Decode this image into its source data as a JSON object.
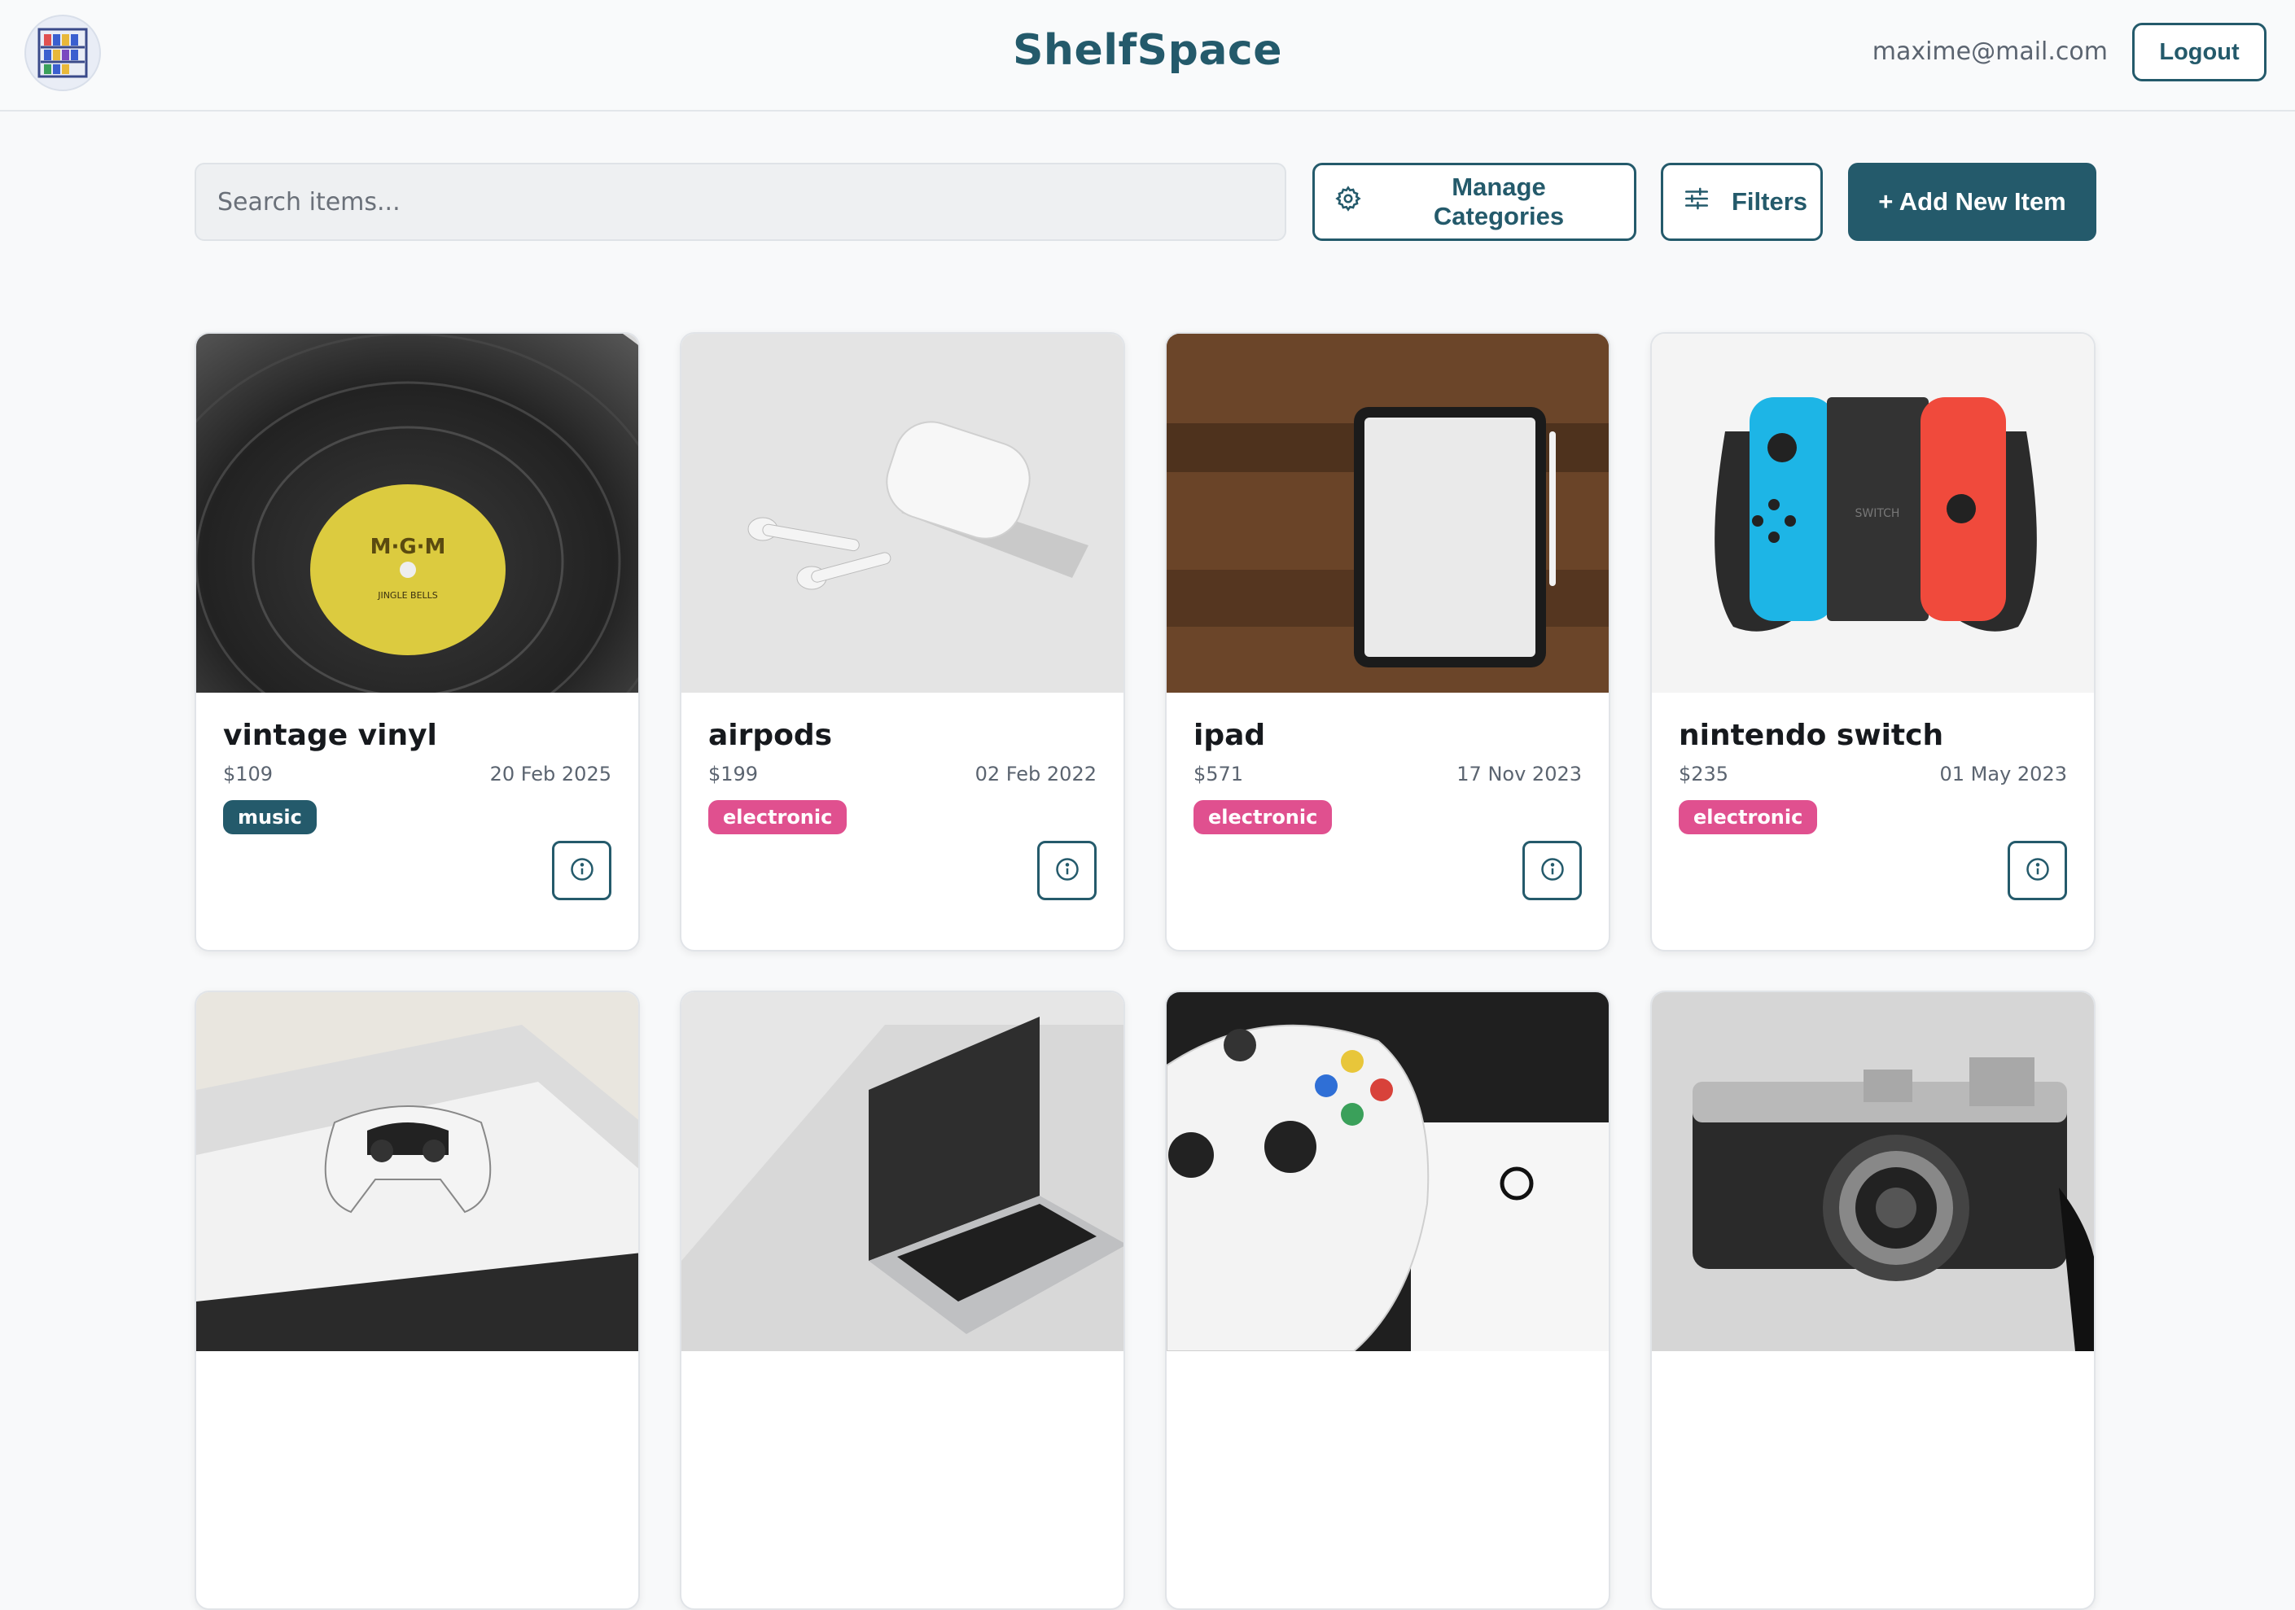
{
  "header": {
    "logo_icon": "shelf-logo-icon",
    "title": "ShelfSpace",
    "user_email": "maxime@mail.com",
    "logout_label": "Logout"
  },
  "toolbar": {
    "search_placeholder": "Search items...",
    "manage_label": "Manage Categories",
    "manage_icon": "gear-icon",
    "filters_label": "Filters",
    "filters_icon": "sliders-icon",
    "add_label": "+ Add New Item"
  },
  "colors": {
    "primary": "#245a6b",
    "tag_music": "#245a6b",
    "tag_electronic": "#e0508f"
  },
  "items": [
    {
      "name": "vintage vinyl",
      "price": "$109",
      "date": "20 Feb 2025",
      "category": "music",
      "image": "vinyl-record"
    },
    {
      "name": "airpods",
      "price": "$199",
      "date": "02 Feb 2022",
      "category": "electronic",
      "image": "earbuds"
    },
    {
      "name": "ipad",
      "price": "$571",
      "date": "17 Nov 2023",
      "category": "electronic",
      "image": "tablet"
    },
    {
      "name": "nintendo switch",
      "price": "$235",
      "date": "01 May 2023",
      "category": "electronic",
      "image": "game-console"
    },
    {
      "image": "playstation-console"
    },
    {
      "image": "laptop"
    },
    {
      "image": "xbox-controller"
    },
    {
      "image": "camera"
    }
  ]
}
